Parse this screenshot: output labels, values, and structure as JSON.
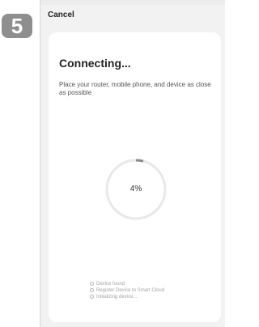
{
  "step_badge": "5",
  "header": {
    "cancel_label": "Cancel"
  },
  "main": {
    "title": "Connecting...",
    "subtitle": "Place your router, mobile phone, and device as close as possible"
  },
  "progress": {
    "value": 0.04,
    "label": "4%"
  },
  "steps": [
    "Device found",
    "Register Device to Smart Cloud",
    "Initializing device..."
  ],
  "colors": {
    "badge_bg": "#8e8e8e",
    "progress_track": "#e8e8e8",
    "progress_fill": "#8a8a8a",
    "phone_bg": "#f2f2f2",
    "card_bg": "#ffffff"
  }
}
